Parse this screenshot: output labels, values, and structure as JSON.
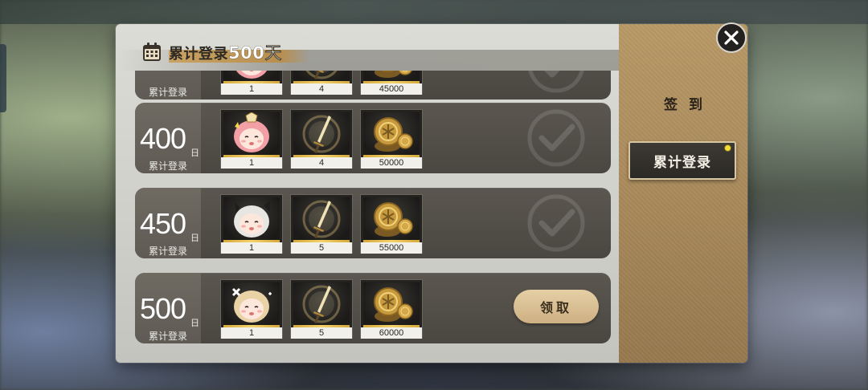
{
  "window": {
    "title_prefix": "累计登录",
    "title_days": "500天"
  },
  "rows": [
    {
      "day_num": "",
      "day_unit": "",
      "day_label": "累计登录",
      "claimed": true,
      "items": [
        {
          "icon": "character-chibi-icon",
          "qty": "1"
        },
        {
          "icon": "sword-icon",
          "qty": "4"
        },
        {
          "icon": "gold-coins-icon",
          "qty": "45000"
        }
      ]
    },
    {
      "day_num": "400",
      "day_unit": "日",
      "day_label": "累计登录",
      "claimed": true,
      "items": [
        {
          "icon": "character-chibi-icon",
          "qty": "1"
        },
        {
          "icon": "sword-icon",
          "qty": "4"
        },
        {
          "icon": "gold-coins-icon",
          "qty": "50000"
        }
      ]
    },
    {
      "day_num": "450",
      "day_unit": "日",
      "day_label": "累计登录",
      "claimed": true,
      "items": [
        {
          "icon": "character-chibi-icon",
          "qty": "1"
        },
        {
          "icon": "sword-icon",
          "qty": "5"
        },
        {
          "icon": "gold-coins-icon",
          "qty": "55000"
        }
      ]
    },
    {
      "day_num": "500",
      "day_unit": "日",
      "day_label": "累计登录",
      "claimed": false,
      "claim_label": "领取",
      "items": [
        {
          "icon": "character-chibi-icon",
          "qty": "1"
        },
        {
          "icon": "sword-icon",
          "qty": "5"
        },
        {
          "icon": "gold-coins-icon",
          "qty": "60000"
        }
      ]
    }
  ],
  "sidebar": {
    "title": "签到",
    "tab_label": "累计登录",
    "tab_has_notification": true
  },
  "icons": {
    "close": "close-icon",
    "calendar": "calendar-icon",
    "claimed_check": "check-circle-icon"
  },
  "colors": {
    "accent_gold": "#c9a363",
    "claim_button": "#e6cfa5",
    "notification_dot": "#f2dc3a"
  }
}
